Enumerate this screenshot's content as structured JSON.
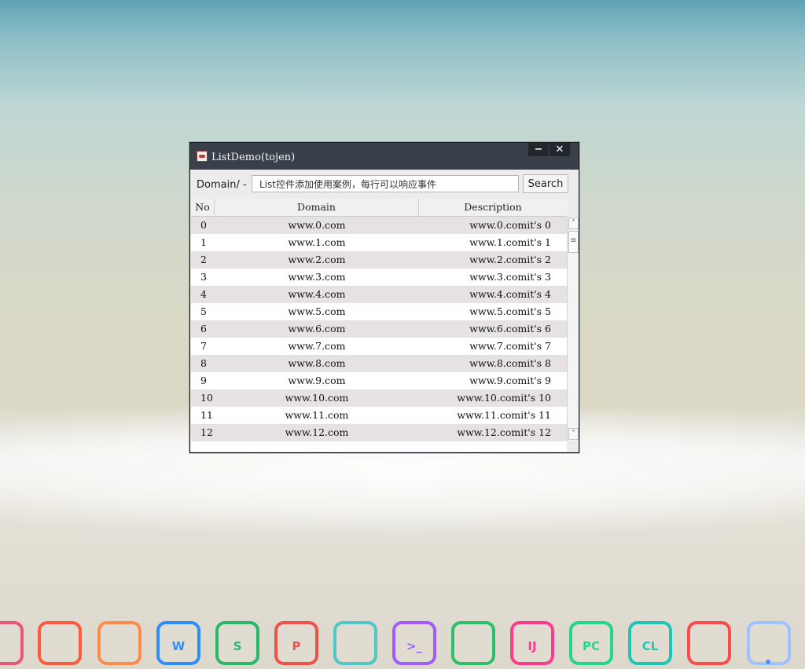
{
  "window": {
    "title": "ListDemo(tojen)",
    "minimize_label": "−",
    "close_label": "✕"
  },
  "toolbar": {
    "domain_label": "Domain/ -",
    "search_value": "List控件添加使用案例，每行可以响应事件",
    "search_button": "Search"
  },
  "table": {
    "columns": [
      "No",
      "Domain",
      "Description"
    ],
    "rows": [
      [
        "0",
        "www.0.com",
        "www.0.comit's 0"
      ],
      [
        "1",
        "www.1.com",
        "www.1.comit's 1"
      ],
      [
        "2",
        "www.2.com",
        "www.2.comit's 2"
      ],
      [
        "3",
        "www.3.com",
        "www.3.comit's 3"
      ],
      [
        "4",
        "www.4.com",
        "www.4.comit's 4"
      ],
      [
        "5",
        "www.5.com",
        "www.5.comit's 5"
      ],
      [
        "6",
        "www.6.com",
        "www.6.comit's 6"
      ],
      [
        "7",
        "www.7.com",
        "www.7.comit's 7"
      ],
      [
        "8",
        "www.8.com",
        "www.8.comit's 8"
      ],
      [
        "9",
        "www.9.com",
        "www.9.comit's 9"
      ],
      [
        "10",
        "www.10.com",
        "www.10.comit's 10"
      ],
      [
        "11",
        "www.11.com",
        "www.11.comit's 11"
      ],
      [
        "12",
        "www.12.com",
        "www.12.comit's 12"
      ]
    ]
  },
  "scrollbar": {
    "up_glyph": "˄",
    "down_glyph": "˅",
    "thumb_glyph": "≡"
  },
  "dock": {
    "items": [
      {
        "icon": "trash-icon",
        "glyph": "",
        "color": "#e8567a"
      },
      {
        "icon": "firefox-icon",
        "glyph": "",
        "color": "#ff5a3c"
      },
      {
        "icon": "file-manager-icon",
        "glyph": "",
        "color": "#ff8a4a"
      },
      {
        "icon": "wps-writer-icon",
        "glyph": "W",
        "color": "#2f8cff"
      },
      {
        "icon": "wps-spreadsheet-icon",
        "glyph": "S",
        "color": "#29b86a"
      },
      {
        "icon": "wps-presentation-icon",
        "glyph": "P",
        "color": "#f0524a"
      },
      {
        "icon": "text-editor-icon",
        "glyph": "",
        "color": "#4fc7c6"
      },
      {
        "icon": "terminal-icon",
        "glyph": ">_",
        "color": "#a05cff"
      },
      {
        "icon": "chrome-icon",
        "glyph": "",
        "color": "#2cc06a"
      },
      {
        "icon": "intellij-idea-icon",
        "glyph": "IJ",
        "color": "#ff3a8c"
      },
      {
        "icon": "pycharm-icon",
        "glyph": "PC",
        "color": "#21d789"
      },
      {
        "icon": "clion-icon",
        "glyph": "CL",
        "color": "#21c5b5"
      },
      {
        "icon": "app-grid-icon",
        "glyph": "",
        "color": "#ff4a4a"
      },
      {
        "icon": "show-desktop-icon",
        "glyph": "",
        "color": "#9cc3ff"
      }
    ]
  }
}
